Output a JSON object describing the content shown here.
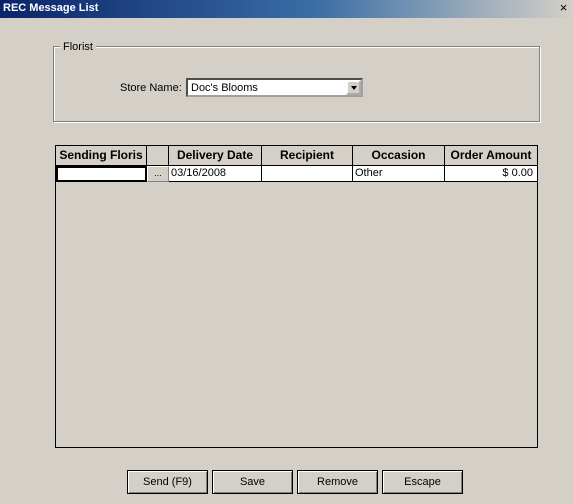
{
  "window": {
    "title": "REC Message List",
    "close_glyph": "×"
  },
  "florist_group": {
    "legend": "Florist",
    "store_name_label": "Store Name:",
    "store_name_value": "Doc's Blooms"
  },
  "grid": {
    "headers": [
      "Sending Floris",
      "",
      "Delivery Date",
      "Recipient",
      "Occasion",
      "Order Amount"
    ],
    "rows": [
      {
        "sending_florist": "",
        "ellipsis": "...",
        "delivery_date": "03/16/2008",
        "recipient": "",
        "occasion": "Other",
        "order_amount": "$      0.00"
      }
    ]
  },
  "buttons": {
    "send": "Send (F9)",
    "save": "Save",
    "remove": "Remove",
    "escape": "Escape"
  }
}
